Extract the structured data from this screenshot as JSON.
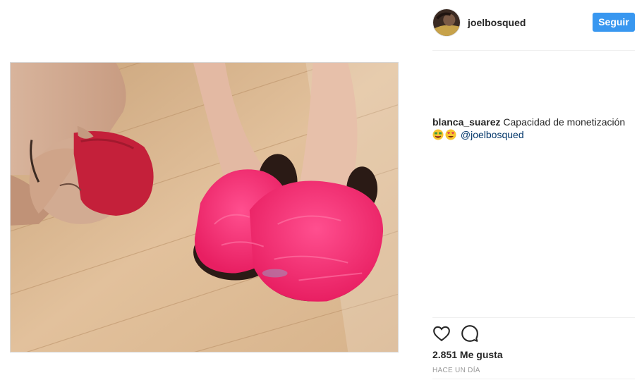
{
  "post": {
    "author": "joelbosqued",
    "follow_label": "Seguir",
    "caption": {
      "commenter": "blanca_suarez",
      "text": "Capacidad de monetización",
      "emojis": [
        "money-face-emoji",
        "heart-eyes-emoji"
      ],
      "mention": "@joelbosqued"
    },
    "likes": "2.851 Me gusta",
    "timestamp": "HACE UN DÍA"
  },
  "icons": {
    "like": "heart-outline-icon",
    "comment": "speech-bubble-icon"
  },
  "colors": {
    "accent": "#3897f0",
    "mention": "#003569",
    "fur": "#f0306e",
    "hair": "#c4203a",
    "floor": "#d9b48a"
  }
}
